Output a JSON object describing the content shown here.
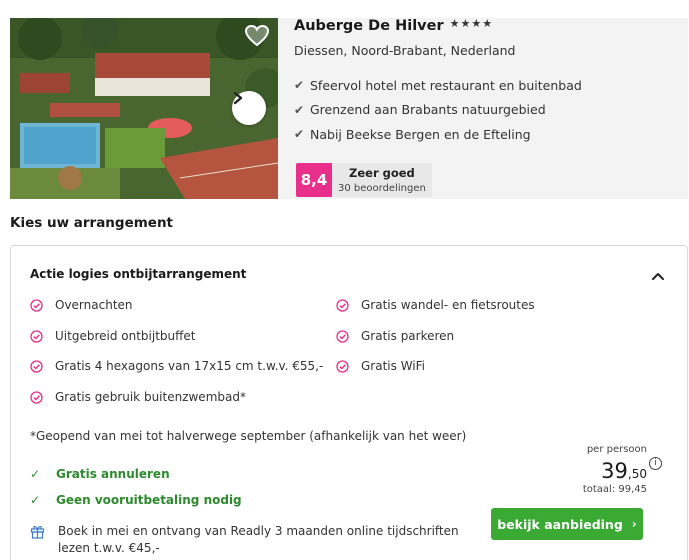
{
  "hotel": {
    "name": "Auberge De Hilver",
    "stars": "★★★★",
    "location": "Diessen, Noord-Brabant, Nederland",
    "features": [
      "Sfeervol hotel met restaurant en buitenbad",
      "Grenzend aan Brabants natuurgebied",
      "Nabij Beekse Bergen en de Efteling"
    ],
    "rating": {
      "score": "8,4",
      "label": "Zeer goed",
      "count": "30 beoordelingen",
      "color": "#e8308a"
    }
  },
  "section_title": "Kies uw arrangement",
  "package": {
    "title": "Actie logies ontbijtarrangement",
    "inclusions_left": [
      "Overnachten",
      "Uitgebreid ontbijtbuffet",
      "Gratis 4 hexagons van 17x15 cm t.w.v. €55,-",
      "Gratis gebruik buitenzwembad*"
    ],
    "inclusions_right": [
      "Gratis wandel- en fietsroutes",
      "Gratis parkeren",
      "Gratis WiFi"
    ],
    "note": "*Geopend van mei tot halverwege september (afhankelijk van het weer)",
    "perks": [
      "Gratis annuleren",
      "Geen vooruitbetaling nodig"
    ],
    "promo": "Boek in mei en ontvang van Readly 3 maanden online tijdschriften lezen t.w.v. €45,-",
    "price": {
      "per_person_label": "per persoon",
      "amount": "39",
      "cents": ",50",
      "total": "totaal: 99,45"
    },
    "cta_label": "bekijk aanbieding",
    "cta_color": "#3aaa35"
  }
}
